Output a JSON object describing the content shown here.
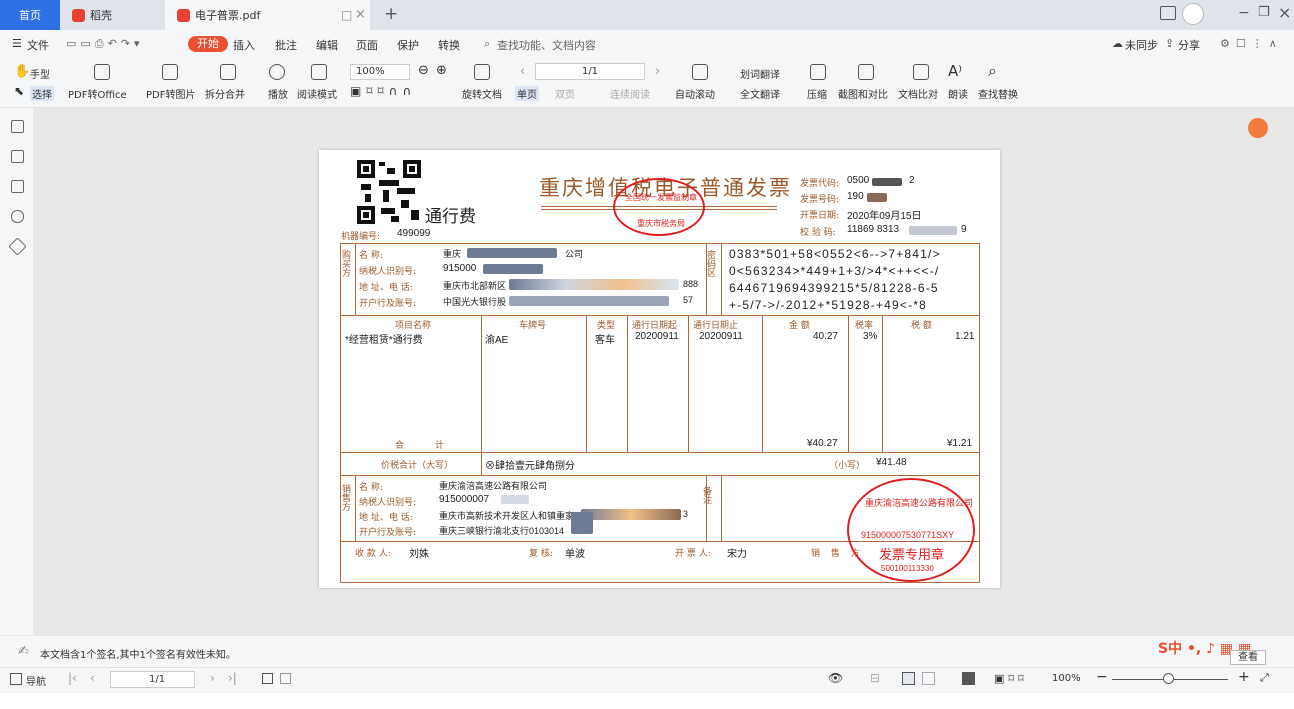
{
  "tabs": {
    "home": "首页",
    "daoke": "稻壳",
    "doc": "电子普票.pdf"
  },
  "menu": {
    "file": "文件",
    "start": "开始",
    "insert": "插入",
    "annotate": "批注",
    "edit": "编辑",
    "page": "页面",
    "protect": "保护",
    "convert": "转换",
    "search_placeholder": "查找功能、文档内容",
    "sync": "未同步",
    "share": "分享"
  },
  "ribbon": {
    "hand": "手型",
    "select": "选择",
    "pdf_office": "PDF转Office",
    "pdf_image": "PDF转图片",
    "split_merge": "拆分合并",
    "play": "播放",
    "read_mode": "阅读模式",
    "zoom": "100%",
    "rotate": "旋转文档",
    "page_num": "1/1",
    "single": "单页",
    "double": "双页",
    "continuous": "连续阅读",
    "auto_scroll": "自动滚动",
    "translate_word": "划词翻译",
    "translate_full": "全文翻译",
    "compress": "压缩",
    "screenshot_compare": "截图和对比",
    "doc_compare": "文档比对",
    "read_aloud": "朗读",
    "find_replace": "查找替换"
  },
  "invoice": {
    "title": "重庆增值税电子普通发票",
    "toll_label": "通行费",
    "machine_no_label": "机器编号:",
    "machine_no": "499099",
    "code_label": "发票代码:",
    "code_val": "0500",
    "code_tail": "2",
    "number_label": "发票号码:",
    "number_val": "190",
    "date_label": "开票日期:",
    "date_val": "2020年09月15日",
    "check_label": "校 验 码:",
    "check_val": "11869 8313",
    "check_tail": "9",
    "buyer": {
      "side_label": "购买方",
      "name_label": "名 称:",
      "name_val": "重庆",
      "name_tail": "公司",
      "tax_label": "纳税人识别号:",
      "tax_val": "915000",
      "addr_label": "地 址、电 话:",
      "addr_val": "重庆市北部新区",
      "addr_tail": "888",
      "bank_label": "开户行及账号:",
      "bank_val": "中国光大银行股",
      "bank_tail": "57"
    },
    "cipher_label": "密码区",
    "cipher": [
      "0383*501+58<0552<6-->7+841/>",
      "0<563234>*449+1+3/>4*<++<<-/",
      "6446719694399215*5/81228-6-5",
      "+-5/7->/-2012+*51928-+49<-*8"
    ],
    "cols": [
      "项目名称",
      "车牌号",
      "类型",
      "通行日期起",
      "通行日期止",
      "金 额",
      "税率",
      "税 额"
    ],
    "row": [
      "*经营租赁*通行费",
      "渝AE",
      "客车",
      "20200911",
      "20200911",
      "40.27",
      "3%",
      "1.21"
    ],
    "total_label": "合 计",
    "total_amount": "¥40.27",
    "total_tax": "¥1.21",
    "tax_total_label": "价税合计（大写）",
    "tax_total_words": "⊗肆拾壹元肆角捌分",
    "small_label": "（小写）",
    "small_val": "¥41.48",
    "seller": {
      "side_label": "销售方",
      "name_label": "名 称:",
      "name_val": "重庆渝涪高速公路有限公司",
      "tax_label": "纳税人识别号:",
      "tax_val": "915000007",
      "addr_label": "地 址、电 话:",
      "addr_val": "重庆市高新技术开发区人和镇重家",
      "addr_tail": "3",
      "bank_label": "开户行及账号:",
      "bank_val": "重庆三峡银行渝北支行0103014"
    },
    "remark_label": "备注",
    "payee_label": "收 款 人:",
    "payee": "刘姝",
    "reviewer_label": "复 核:",
    "reviewer": "单波",
    "drawer_label": "开 票 人:",
    "drawer": "宋力",
    "seller_sign_label": "销 售 方",
    "seal_top": "全国统一发票监制章",
    "seal_bottom": "重庆市税务局",
    "seal2_name": "重庆渝涪高速公路有限公司",
    "seal2_no": "915000007530771SXY",
    "seal2_text": "发票专用章",
    "seal2_bottom": "500100113330"
  },
  "status": {
    "signature_info": "本文档含1个签名,其中1个签名有效性未知。",
    "view": "查看"
  },
  "bottom": {
    "nav": "导航",
    "page": "1/1",
    "zoom": "100%"
  },
  "colors": {
    "accent": "#2f6fe6",
    "start": "#e8502f",
    "stamp": "#e02020",
    "invoice": "#9b5a2c"
  }
}
